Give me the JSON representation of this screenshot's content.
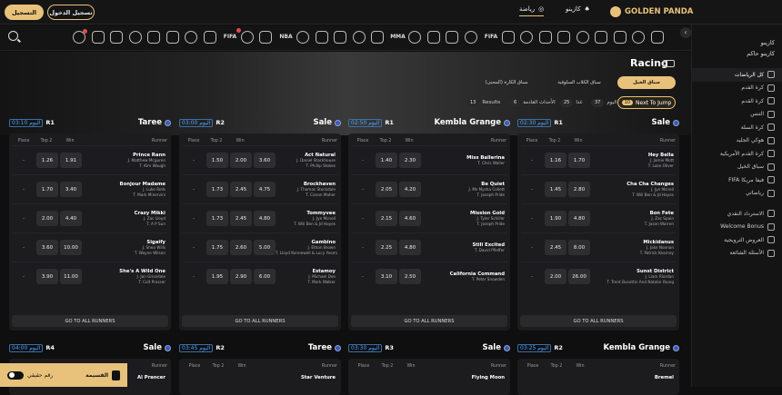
{
  "header": {
    "register": "تسجيل الدخول",
    "login": "التسجيل",
    "casino": "كازينو",
    "sports": "رياضة",
    "brand": "GOLDEN PANDA"
  },
  "sidebar": {
    "top": [
      "كازينو",
      "كازينو حاكم"
    ],
    "items": [
      "كل الرياضات",
      "كرة القدم",
      "كرة القدم",
      "التنس",
      "كرة السلة",
      "هوكي الجليد",
      "كرة القدم الأمريكية",
      "سباق الخيل",
      "FIFA فيفا مريكا",
      "رياضاتي"
    ],
    "bottom": [
      "الاسترداد النقدي",
      "Welcome Bonus",
      "العروض الترويجية",
      "الأسئلة الشائعة"
    ]
  },
  "hero": {
    "title": "Racing",
    "chips": [
      "سباق الخيل",
      "سباق الكلاب السلوقية",
      "سباق الكارة (المحنى)"
    ]
  },
  "filters": {
    "results_label": "Results",
    "results_count": "13",
    "upcoming_label": "الأحداث القادمة",
    "upcoming_count": "6",
    "tomorrow_label": "غدا",
    "tomorrow_count": "25",
    "today_label": "اليوم",
    "today_count": "37",
    "next_label": "Next To Jump",
    "next_count": "10"
  },
  "table_headers": {
    "place": "Place",
    "top2": "Top 2",
    "win": "Win",
    "runner": "Runner"
  },
  "go_all": "GO TO ALL RUNNERS",
  "meetings": [
    {
      "time": "03:10 اليوم",
      "race": "R1",
      "venue": "Taree",
      "rows": [
        {
          "place": "-",
          "top2": "1.26",
          "win": "1.91",
          "name": "Prince Rann",
          "j": "J. Matthew Mcguren",
          "t": "T. Kim Waugh"
        },
        {
          "place": "-",
          "top2": "1.70",
          "win": "3.40",
          "name": "Bonjour Madame",
          "j": "J. Luke Rolls",
          "t": "T. Mark Minervini"
        },
        {
          "place": "-",
          "top2": "2.00",
          "win": "4.40",
          "name": "Crazy Mikki",
          "j": "J. Zac Lloyd",
          "t": "T. A P Sun"
        },
        {
          "place": "-",
          "top2": "3.60",
          "win": "10.00",
          "name": "Sigaify",
          "j": "J. Shea Wills",
          "t": "T. Wayne Wilson"
        },
        {
          "place": "-",
          "top2": "3.90",
          "win": "11.00",
          "name": "She's A Wild One",
          "j": "J. Jon Grisedale",
          "t": "T. Colt Prosser"
        }
      ]
    },
    {
      "time": "03:00 اليوم",
      "race": "R2",
      "venue": "Sale",
      "rows": [
        {
          "place": "-",
          "top2": "1.50",
          "win": "2.00",
          "top3": "3.60",
          "name": "Act Natural",
          "j": "J. Daniel Stackhouse",
          "t": "T. Phillip Stokes"
        },
        {
          "place": "-",
          "top2": "1.73",
          "win": "2.45",
          "top3": "4.75",
          "name": "Brockhaven",
          "j": "J. Thomas Stockdale",
          "t": "T. Ciaron Maher"
        },
        {
          "place": "-",
          "top2": "1.73",
          "win": "2.45",
          "top3": "4.80",
          "name": "Tommyvee",
          "j": "J. Jye Mcneil",
          "t": "T. Will Ben & Jd Hayes"
        },
        {
          "place": "-",
          "top2": "1.75",
          "win": "2.60",
          "top3": "5.00",
          "name": "Gambino",
          "j": "J. Ethan Brown",
          "t": "T. Lloyd Kennewell & Lucy Yeoman"
        },
        {
          "place": "-",
          "top2": "1.95",
          "win": "2.90",
          "top3": "6.00",
          "name": "Estamoy",
          "j": "J. Michael Dee",
          "t": "T. Mark Walker"
        }
      ]
    },
    {
      "time": "02:50 اليوم",
      "race": "R1",
      "venue": "Kembla Grange",
      "rows": [
        {
          "place": "-",
          "top2": "1.40",
          "win": "2.30",
          "name": "Miss Ballerina",
          "j": "",
          "t": "T. Chris Waller"
        },
        {
          "place": "-",
          "top2": "2.05",
          "win": "4.20",
          "name": "Be Quiet",
          "j": "J. Ms Mysha Collett",
          "t": "T. Joseph Pride"
        },
        {
          "place": "-",
          "top2": "2.15",
          "win": "4.60",
          "name": "Mission Gold",
          "j": "J. Tyler Schiller",
          "t": "T. Joseph Pride"
        },
        {
          "place": "-",
          "top2": "2.25",
          "win": "4.80",
          "name": "Still Excited",
          "j": "",
          "t": "T. David Pfieffer"
        },
        {
          "place": "-",
          "top2": "3.10",
          "win": "2.50",
          "name": "California Command",
          "j": "",
          "t": "T. Peter Snowden"
        }
      ]
    },
    {
      "time": "02:30 اليوم",
      "race": "R1",
      "venue": "Sale",
      "rows": [
        {
          "place": "-",
          "top2": "1.16",
          "win": "1.70",
          "name": "Hey Bella",
          "j": "J. Jamie Mott",
          "t": "T. Luke Oliver"
        },
        {
          "place": "-",
          "top2": "1.45",
          "win": "2.80",
          "name": "Cha Cha Changes",
          "j": "J. Jye Mcneil",
          "t": "T. Will Ben & Jd Hayes"
        },
        {
          "place": "-",
          "top2": "1.90",
          "win": "4.80",
          "name": "Bon Fete",
          "j": "J. Zac Spain",
          "t": "T. Jason Warren"
        },
        {
          "place": "-",
          "top2": "2.45",
          "win": "8.00",
          "name": "Mickidanus",
          "j": "J. Jake Noonan",
          "t": "T. Patrick Kearney"
        },
        {
          "place": "-",
          "top2": "2.00",
          "win": "26.00",
          "name": "Sunst District",
          "j": "J. Liam Riordan",
          "t": "T. Trent Busuttin And Natalie Young"
        }
      ]
    }
  ],
  "next_meetings": [
    {
      "time": "04:00 اليوم",
      "race": "R4",
      "venue": "Sale",
      "first": "Al Prancer"
    },
    {
      "time": "03:45 اليوم",
      "race": "R2",
      "venue": "Taree",
      "first": "Star Venture"
    },
    {
      "time": "03:30 اليوم",
      "race": "R3",
      "venue": "Sale",
      "first": "Flying Moon"
    },
    {
      "time": "03:25 اليوم",
      "race": "R2",
      "venue": "Kembla Grange",
      "first": "Bremel"
    }
  ],
  "bottombar": {
    "toggle_label": "رقم حقيقي",
    "slip": "القسيمة"
  }
}
